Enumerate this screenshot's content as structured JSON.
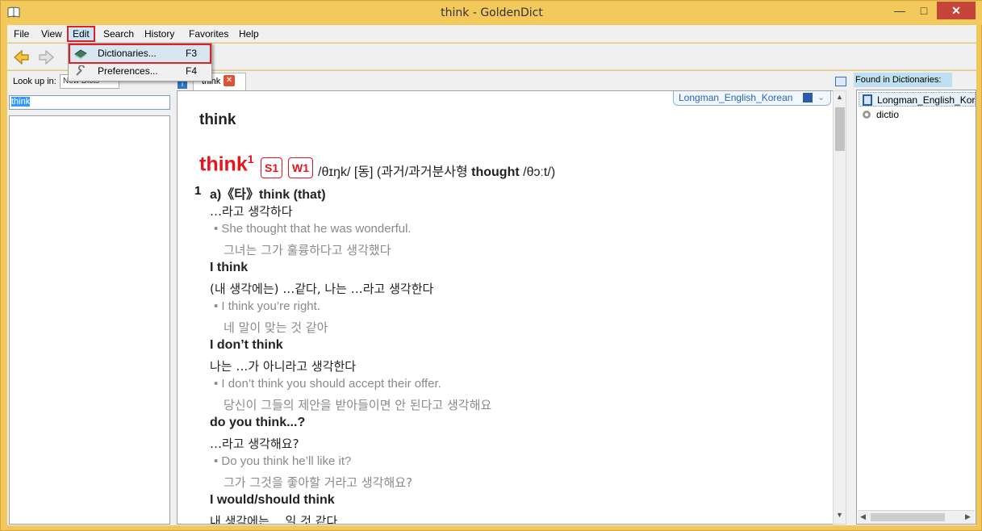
{
  "window": {
    "title": "think - GoldenDict"
  },
  "menubar": [
    "File",
    "View",
    "Edit",
    "Search",
    "History",
    "Favorites",
    "Help"
  ],
  "edit_menu": [
    {
      "label": "Dictionaries...",
      "shortcut": "F3",
      "icon": "dictionaries-icon"
    },
    {
      "label": "Preferences...",
      "shortcut": "F4",
      "icon": "wrench-icon"
    }
  ],
  "left_pane": {
    "lookup_label": "Look up in:",
    "group": "New Dicts",
    "search_value": "think"
  },
  "tab": {
    "label": "think"
  },
  "article": {
    "dict_badge": "Longman_English_Korean",
    "headword_plain": "think",
    "headword": "think",
    "headword_sup": "1",
    "levels": [
      "S1",
      "W1"
    ],
    "pron_pre": "/θɪŋk/ [동] (과거/과거분사형 ",
    "pron_bold": "thought",
    "pron_post": " /θɔːt/)",
    "sense_num": "1",
    "lines": [
      {
        "kind": "bold",
        "text": "a)《타》think (that)"
      },
      {
        "kind": "ko",
        "text": "…라고 생각하다"
      },
      {
        "kind": "ex",
        "text": "• She thought that he was wonderful."
      },
      {
        "kind": "exko",
        "text": "그녀는 그가 훌륭하다고 생각했다"
      },
      {
        "kind": "bold",
        "text": "I think"
      },
      {
        "kind": "ko",
        "text": "(내 생각에는) …같다, 나는 …라고 생각한다"
      },
      {
        "kind": "ex",
        "text": "• I think you’re right."
      },
      {
        "kind": "exko",
        "text": "네 말이 맞는 것 같아"
      },
      {
        "kind": "bold",
        "text": "I don’t think"
      },
      {
        "kind": "ko",
        "text": "나는 …가 아니라고 생각한다"
      },
      {
        "kind": "ex",
        "text": "• I don’t think you should accept their offer."
      },
      {
        "kind": "exko",
        "text": "당신이 그들의 제안을 받아들이면 안 된다고 생각해요"
      },
      {
        "kind": "bold",
        "text": "do you think...?"
      },
      {
        "kind": "ko",
        "text": "…라고 생각해요?"
      },
      {
        "kind": "ex",
        "text": "• Do you think he’ll like it?"
      },
      {
        "kind": "exko",
        "text": "그가 그것을 좋아할 거라고 생각해요?"
      },
      {
        "kind": "bold",
        "text": "I would/should think"
      },
      {
        "kind": "ko",
        "text": "내 생각에는 …일 것 같다"
      }
    ]
  },
  "found": {
    "label": "Found in Dictionaries:",
    "items": [
      {
        "name": "Longman_English_Korean"
      },
      {
        "name": "dictio"
      }
    ]
  }
}
